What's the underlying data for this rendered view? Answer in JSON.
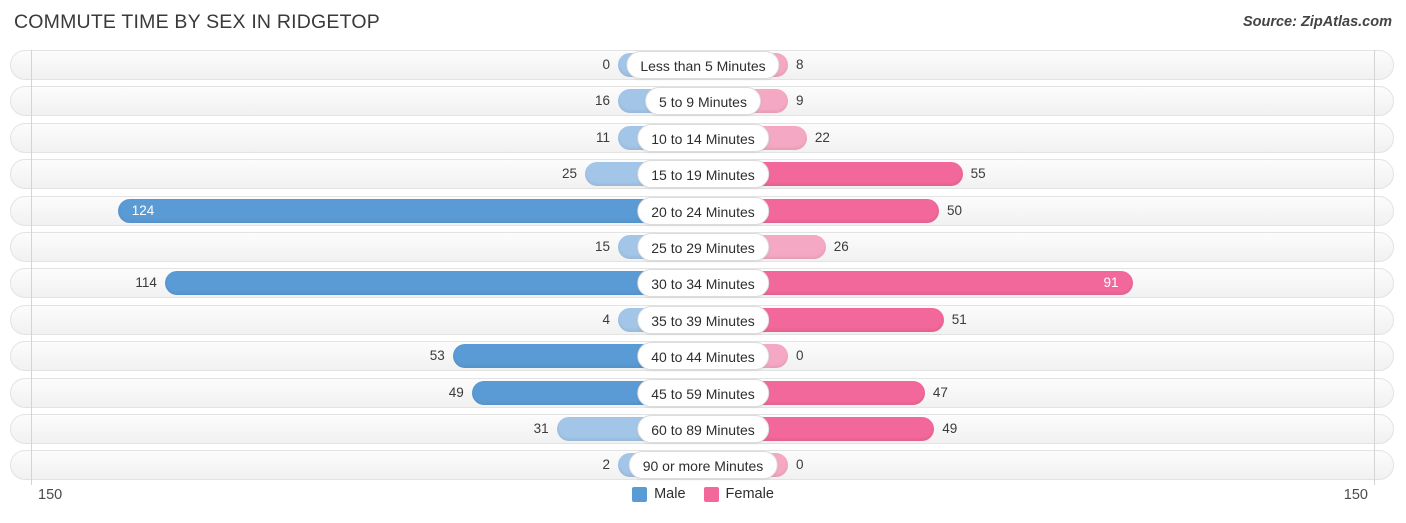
{
  "header": {
    "title": "COMMUTE TIME BY SEX IN RIDGETOP",
    "source": "Source: ZipAtlas.com"
  },
  "axis": {
    "left_max": "150",
    "right_max": "150"
  },
  "legend": {
    "items": [
      {
        "label": "Male",
        "color": "#5b9bd5"
      },
      {
        "label": "Female",
        "color": "#f2689a"
      }
    ]
  },
  "colors": {
    "male_light": "#a3c6e8",
    "male_dark": "#5b9bd5",
    "female_light": "#f5a8c4",
    "female_dark": "#f2689a",
    "track": "#f4f4f4",
    "axis": "#d4d4d4"
  },
  "chart_data": {
    "type": "bar",
    "title": "COMMUTE TIME BY SEX IN RIDGETOP",
    "subtitle": "Source: ZipAtlas.com",
    "orientation": "horizontal",
    "layout": "diverging-bidirectional",
    "xlabel": "",
    "ylabel": "",
    "xlim": [
      150,
      150
    ],
    "axis_max": 150,
    "grid": false,
    "legend_position": "bottom-center",
    "categories": [
      "Less than 5 Minutes",
      "5 to 9 Minutes",
      "10 to 14 Minutes",
      "15 to 19 Minutes",
      "20 to 24 Minutes",
      "25 to 29 Minutes",
      "30 to 34 Minutes",
      "35 to 39 Minutes",
      "40 to 44 Minutes",
      "45 to 59 Minutes",
      "60 to 89 Minutes",
      "90 or more Minutes"
    ],
    "series": [
      {
        "name": "Male",
        "values": [
          0,
          16,
          11,
          25,
          124,
          15,
          114,
          4,
          53,
          49,
          31,
          2
        ]
      },
      {
        "name": "Female",
        "values": [
          8,
          9,
          22,
          55,
          50,
          26,
          91,
          51,
          0,
          47,
          49,
          0
        ]
      }
    ]
  },
  "rows": [
    {
      "label": "Less than 5 Minutes",
      "male": "0",
      "female": "8"
    },
    {
      "label": "5 to 9 Minutes",
      "male": "16",
      "female": "9"
    },
    {
      "label": "10 to 14 Minutes",
      "male": "11",
      "female": "22"
    },
    {
      "label": "15 to 19 Minutes",
      "male": "25",
      "female": "55"
    },
    {
      "label": "20 to 24 Minutes",
      "male": "124",
      "female": "50"
    },
    {
      "label": "25 to 29 Minutes",
      "male": "15",
      "female": "26"
    },
    {
      "label": "30 to 34 Minutes",
      "male": "114",
      "female": "91"
    },
    {
      "label": "35 to 39 Minutes",
      "male": "4",
      "female": "51"
    },
    {
      "label": "40 to 44 Minutes",
      "male": "53",
      "female": "0"
    },
    {
      "label": "45 to 59 Minutes",
      "male": "49",
      "female": "47"
    },
    {
      "label": "60 to 89 Minutes",
      "male": "31",
      "female": "49"
    },
    {
      "label": "90 or more Minutes",
      "male": "2",
      "female": "0"
    }
  ]
}
